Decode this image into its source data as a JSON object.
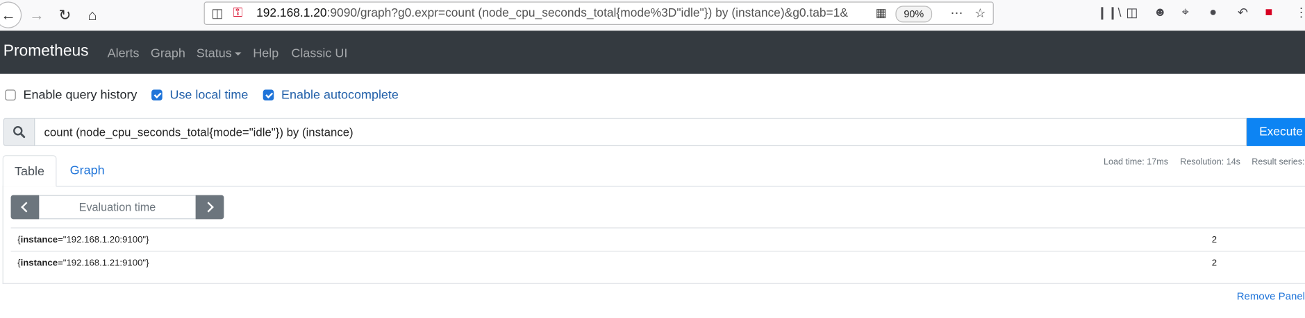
{
  "browser": {
    "url_host": "192.168.1.20",
    "url_rest": ":9090/graph?g0.expr=count (node_cpu_seconds_total{mode%3D\"idle\"}) by (instance)&g0.tab=1&",
    "zoom": "90%",
    "icons": [
      "back-icon",
      "forward-icon",
      "reload-icon",
      "home-icon",
      "shield-icon",
      "insecure-lock-icon",
      "qr-icon",
      "more-icon",
      "star-icon",
      "library-icon",
      "sidebar-icon",
      "account-icon",
      "crop-icon",
      "chat-icon",
      "undo-icon",
      "extension-icon",
      "menu-icon"
    ]
  },
  "navbar": {
    "brand": "Prometheus",
    "links": [
      "Alerts",
      "Graph",
      "Status",
      "Help",
      "Classic UI"
    ]
  },
  "options": {
    "query_history": {
      "label": "Enable query history",
      "checked": false
    },
    "local_time": {
      "label": "Use local time",
      "checked": true
    },
    "autocomplete": {
      "label": "Enable autocomplete",
      "checked": true
    }
  },
  "query": {
    "expression": "count (node_cpu_seconds_total{mode=\"idle\"}) by (instance)",
    "execute_label": "Execute"
  },
  "panel": {
    "tabs": [
      "Table",
      "Graph"
    ],
    "active_tab": "Table",
    "load_time": "Load time: 17ms",
    "resolution": "Resolution: 14s",
    "result_series": "Result series:",
    "eval_placeholder": "Evaluation time",
    "rows": [
      {
        "label_open": "{",
        "label_key": "instance",
        "label_rest": "=\"192.168.1.20:9100\"}",
        "value": "2"
      },
      {
        "label_open": "{",
        "label_key": "instance",
        "label_rest": "=\"192.168.1.21:9100\"}",
        "value": "2"
      }
    ],
    "remove_label": "Remove Panel"
  },
  "colors": {
    "navbar_bg": "#343a40",
    "execute_bg": "#0d84f3",
    "link": "#1f74d9",
    "checkbox_checked": "#1f74d9"
  }
}
